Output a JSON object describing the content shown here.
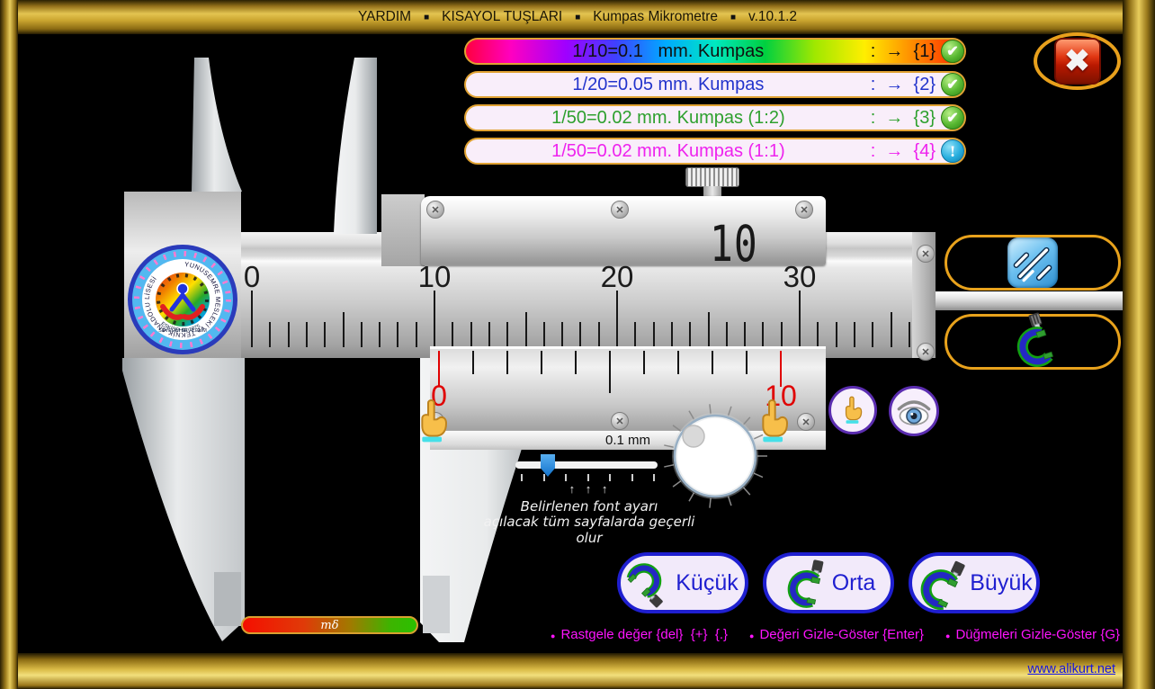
{
  "titlebar": {
    "separator": "■",
    "items": [
      "YARDIM",
      "KISAYOL TUŞLARI",
      "Kumpas Mikrometre",
      "v.10.1.2"
    ]
  },
  "menu": {
    "buttons": [
      {
        "label": "1/10=0.1   mm. Kumpas",
        "suffix": ":  →  {1}",
        "status": "ok"
      },
      {
        "label": "1/20=0.05 mm. Kumpas",
        "suffix": ":  →  {2}",
        "status": "ok"
      },
      {
        "label": "1/50=0.02 mm. Kumpas (1:2)",
        "suffix": ":  →  {3}",
        "status": "ok"
      },
      {
        "label": "1/50=0.02 mm. Kumpas (1:1)",
        "suffix": ":  →  {4}",
        "status": "warn"
      }
    ],
    "warn_glyph": "!",
    "ok_glyph": "✔"
  },
  "close_glyph": "✖",
  "caliper": {
    "display_value": "10",
    "main_scale": {
      "unit": "mm",
      "tick_count": 38,
      "numbered": [
        0,
        10,
        20,
        30
      ]
    },
    "vernier": {
      "divisions": 10,
      "left_label": "0",
      "right_label": "10",
      "resolution_label": "0.1 mm"
    }
  },
  "logo": {
    "ring_text": "YUNUSEMRE MESLEKİ ve TEKNİK ANADOLU LİSESİ",
    "motto": "SEVELİM SEVİLELİM",
    "bottom_text": "ESKİŞEHİR 1975"
  },
  "font_slider": {
    "arrows": "↑ ↑ ↑",
    "caption_line1": "Belirlenen font ayarı",
    "caption_line2": "açılacak tüm sayfalarda geçerli olur"
  },
  "gauge_pill": {
    "text": "mδ"
  },
  "size_buttons": [
    {
      "label": "Küçük"
    },
    {
      "label": "Orta"
    },
    {
      "label": "Büyük"
    }
  ],
  "hints": [
    {
      "text": "Rastgele değer {del}  {+}  {.}"
    },
    {
      "text": "Değeri Gizle-Göster {Enter}"
    },
    {
      "text": "Düğmeleri Gizle-Göster {G}"
    }
  ],
  "footer": {
    "link": "www.alikurt.net"
  },
  "colors": {
    "gold": "#d9b945",
    "magenta": "#ff14ff",
    "blue": "#1f1fd0",
    "red": "#e00000",
    "green": "#2ea02e"
  }
}
